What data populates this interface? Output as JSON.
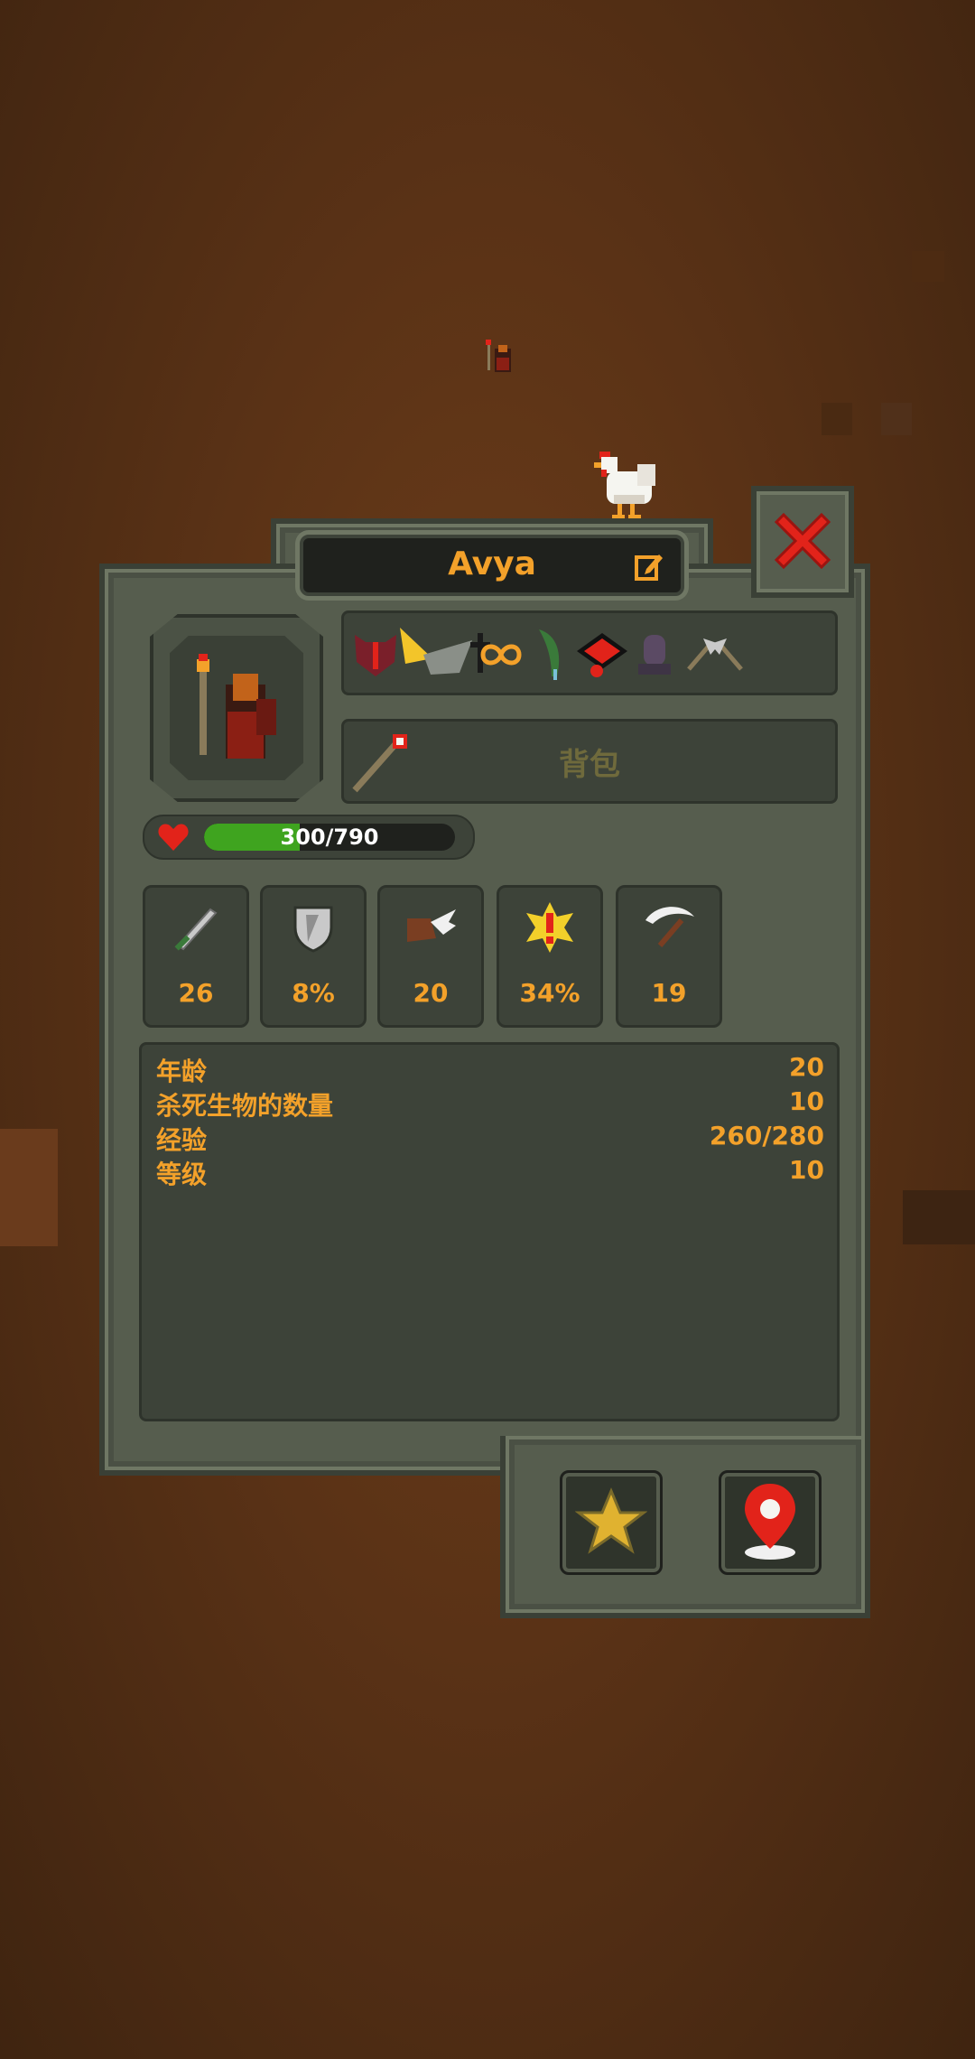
{
  "character": {
    "name": "Avya"
  },
  "inventory": {
    "bag_label": "背包"
  },
  "health": {
    "current": 300,
    "max": 790,
    "text": "300/790"
  },
  "stats": [
    {
      "icon": "sword-icon",
      "value": "26"
    },
    {
      "icon": "shield-icon",
      "value": "8%"
    },
    {
      "icon": "winged-boot-icon",
      "value": "20"
    },
    {
      "icon": "critical-burst-icon",
      "value": "34%"
    },
    {
      "icon": "scythe-icon",
      "value": "19"
    }
  ],
  "info": [
    {
      "label": "年龄",
      "value": "20"
    },
    {
      "label": "杀死生物的数量",
      "value": "10"
    },
    {
      "label": "经验",
      "value": "260/280"
    },
    {
      "label": "等级",
      "value": "10"
    }
  ],
  "status_effects": [
    "demon-mask-icon",
    "golden-wings-icon",
    "black-cross-icon",
    "infinity-icon",
    "green-feather-icon",
    "red-eye-icon",
    "tombstone-icon",
    "twin-axes-icon"
  ],
  "colors": {
    "accent": "#f3a12a",
    "panel": "#565d4e",
    "inner": "#3d4339",
    "hp_fill": "#3fa41f",
    "close": "#e2231a"
  }
}
